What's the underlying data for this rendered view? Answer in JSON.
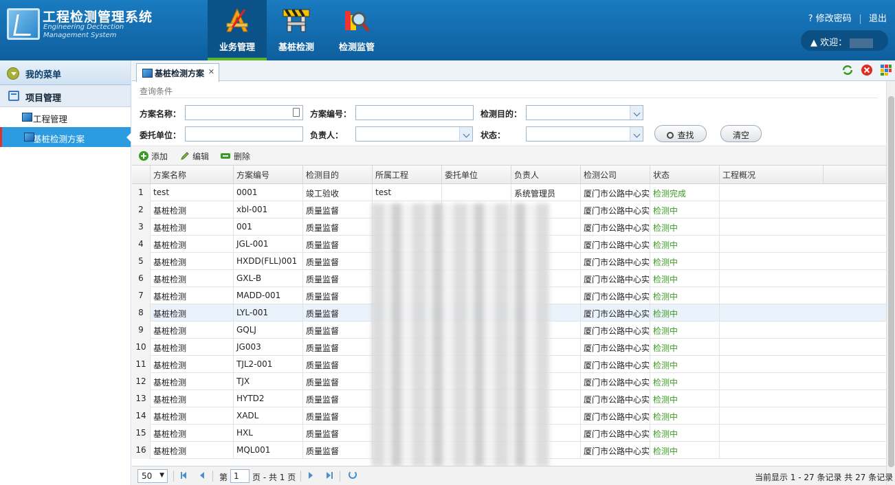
{
  "header": {
    "title": "工程检测管理系统",
    "subtitle_line1": "Engineering Dectection",
    "subtitle_line2": "Management System",
    "nav": [
      {
        "label": "业务管理",
        "icon": "tools-icon",
        "active": true
      },
      {
        "label": "基桩检测",
        "icon": "barrier-icon",
        "active": false
      },
      {
        "label": "检测监管",
        "icon": "magnifier-chart-icon",
        "active": false
      }
    ],
    "change_password": "修改密码",
    "logout": "退出",
    "welcome": "欢迎："
  },
  "sidebar": {
    "menu_title": "我的菜单",
    "group": "项目管理",
    "items": [
      {
        "label": "工程管理",
        "active": false
      },
      {
        "label": "基桩检测方案",
        "active": true
      }
    ]
  },
  "tab": {
    "label": "基桩检测方案"
  },
  "query": {
    "title": "查询条件",
    "plan_name": "方案名称：",
    "plan_no": "方案编号：",
    "purpose": "检测目的：",
    "client": "委托单位：",
    "owner": "负责人：",
    "status": "状态：",
    "search_btn": "查找",
    "clear_btn": "清空"
  },
  "toolbar": {
    "add": "添加",
    "edit": "编辑",
    "delete": "删除"
  },
  "grid": {
    "columns": [
      "方案名称",
      "方案编号",
      "检测目的",
      "所属工程",
      "委托单位",
      "负责人",
      "检测公司",
      "状态",
      "工程概况"
    ],
    "rows": [
      {
        "n": "1",
        "name": "test",
        "code": "0001",
        "purpose": "竣工验收",
        "project": "test",
        "client": "",
        "owner": "系统管理员",
        "company": "厦门市公路中心实",
        "status": "检测完成"
      },
      {
        "n": "2",
        "name": "基桩检测",
        "code": "xbl-001",
        "purpose": "质量监督",
        "project": "",
        "client": "",
        "owner": "",
        "company": "厦门市公路中心实",
        "status": "检测中"
      },
      {
        "n": "3",
        "name": "基桩检测",
        "code": "001",
        "purpose": "质量监督",
        "project": "",
        "client": "",
        "owner": "",
        "company": "厦门市公路中心实",
        "status": "检测中"
      },
      {
        "n": "4",
        "name": "基桩检测",
        "code": "JGL-001",
        "purpose": "质量监督",
        "project": "",
        "client": "",
        "owner": "",
        "company": "厦门市公路中心实",
        "status": "检测中"
      },
      {
        "n": "5",
        "name": "基桩检测",
        "code": "HXDD(FLL)001",
        "purpose": "质量监督",
        "project": "",
        "client": "",
        "owner": "",
        "company": "厦门市公路中心实",
        "status": "检测中"
      },
      {
        "n": "6",
        "name": "基桩检测",
        "code": "GXL-B",
        "purpose": "质量监督",
        "project": "",
        "client": "",
        "owner": "",
        "company": "厦门市公路中心实",
        "status": "检测中"
      },
      {
        "n": "7",
        "name": "基桩检测",
        "code": "MADD-001",
        "purpose": "质量监督",
        "project": "",
        "client": "",
        "owner": "",
        "company": "厦门市公路中心实",
        "status": "检测中"
      },
      {
        "n": "8",
        "name": "基桩检测",
        "code": "LYL-001",
        "purpose": "质量监督",
        "project": "",
        "client": "",
        "owner": "",
        "company": "厦门市公路中心实",
        "status": "检测中",
        "selected": true
      },
      {
        "n": "9",
        "name": "基桩检测",
        "code": "GQLJ",
        "purpose": "质量监督",
        "project": "",
        "client": "",
        "owner": "",
        "company": "厦门市公路中心实",
        "status": "检测中"
      },
      {
        "n": "10",
        "name": "基桩检测",
        "code": "JG003",
        "purpose": "质量监督",
        "project": "",
        "client": "",
        "owner": "",
        "company": "厦门市公路中心实",
        "status": "检测中"
      },
      {
        "n": "11",
        "name": "基桩检测",
        "code": "TJL2-001",
        "purpose": "质量监督",
        "project": "",
        "client": "",
        "owner": "",
        "company": "厦门市公路中心实",
        "status": "检测中"
      },
      {
        "n": "12",
        "name": "基桩检测",
        "code": "TJX",
        "purpose": "质量监督",
        "project": "",
        "client": "",
        "owner": "",
        "company": "厦门市公路中心实",
        "status": "检测中"
      },
      {
        "n": "13",
        "name": "基桩检测",
        "code": "HYTD2",
        "purpose": "质量监督",
        "project": "",
        "client": "",
        "owner": "",
        "company": "厦门市公路中心实",
        "status": "检测中"
      },
      {
        "n": "14",
        "name": "基桩检测",
        "code": "XADL",
        "purpose": "质量监督",
        "project": "",
        "client": "",
        "owner": "",
        "company": "厦门市公路中心实",
        "status": "检测中"
      },
      {
        "n": "15",
        "name": "基桩检测",
        "code": "HXL",
        "purpose": "质量监督",
        "project": "",
        "client": "",
        "owner": "",
        "company": "厦门市公路中心实",
        "status": "检测中"
      },
      {
        "n": "16",
        "name": "基桩检测",
        "code": "MQL001",
        "purpose": "质量监督",
        "project": "",
        "client": "",
        "owner": "",
        "company": "厦门市公路中心实",
        "status": "检测中"
      }
    ]
  },
  "pager": {
    "page_size": "50",
    "page_label": "第",
    "page_value": "1",
    "page_total": "页 - 共 1 页",
    "summary": "当前显示 1 - 27 条记录 共 27 条记录"
  },
  "colors": {
    "header": "#0e5f9e",
    "accent": "#2c9be0",
    "status_green": "#3a9b23"
  }
}
